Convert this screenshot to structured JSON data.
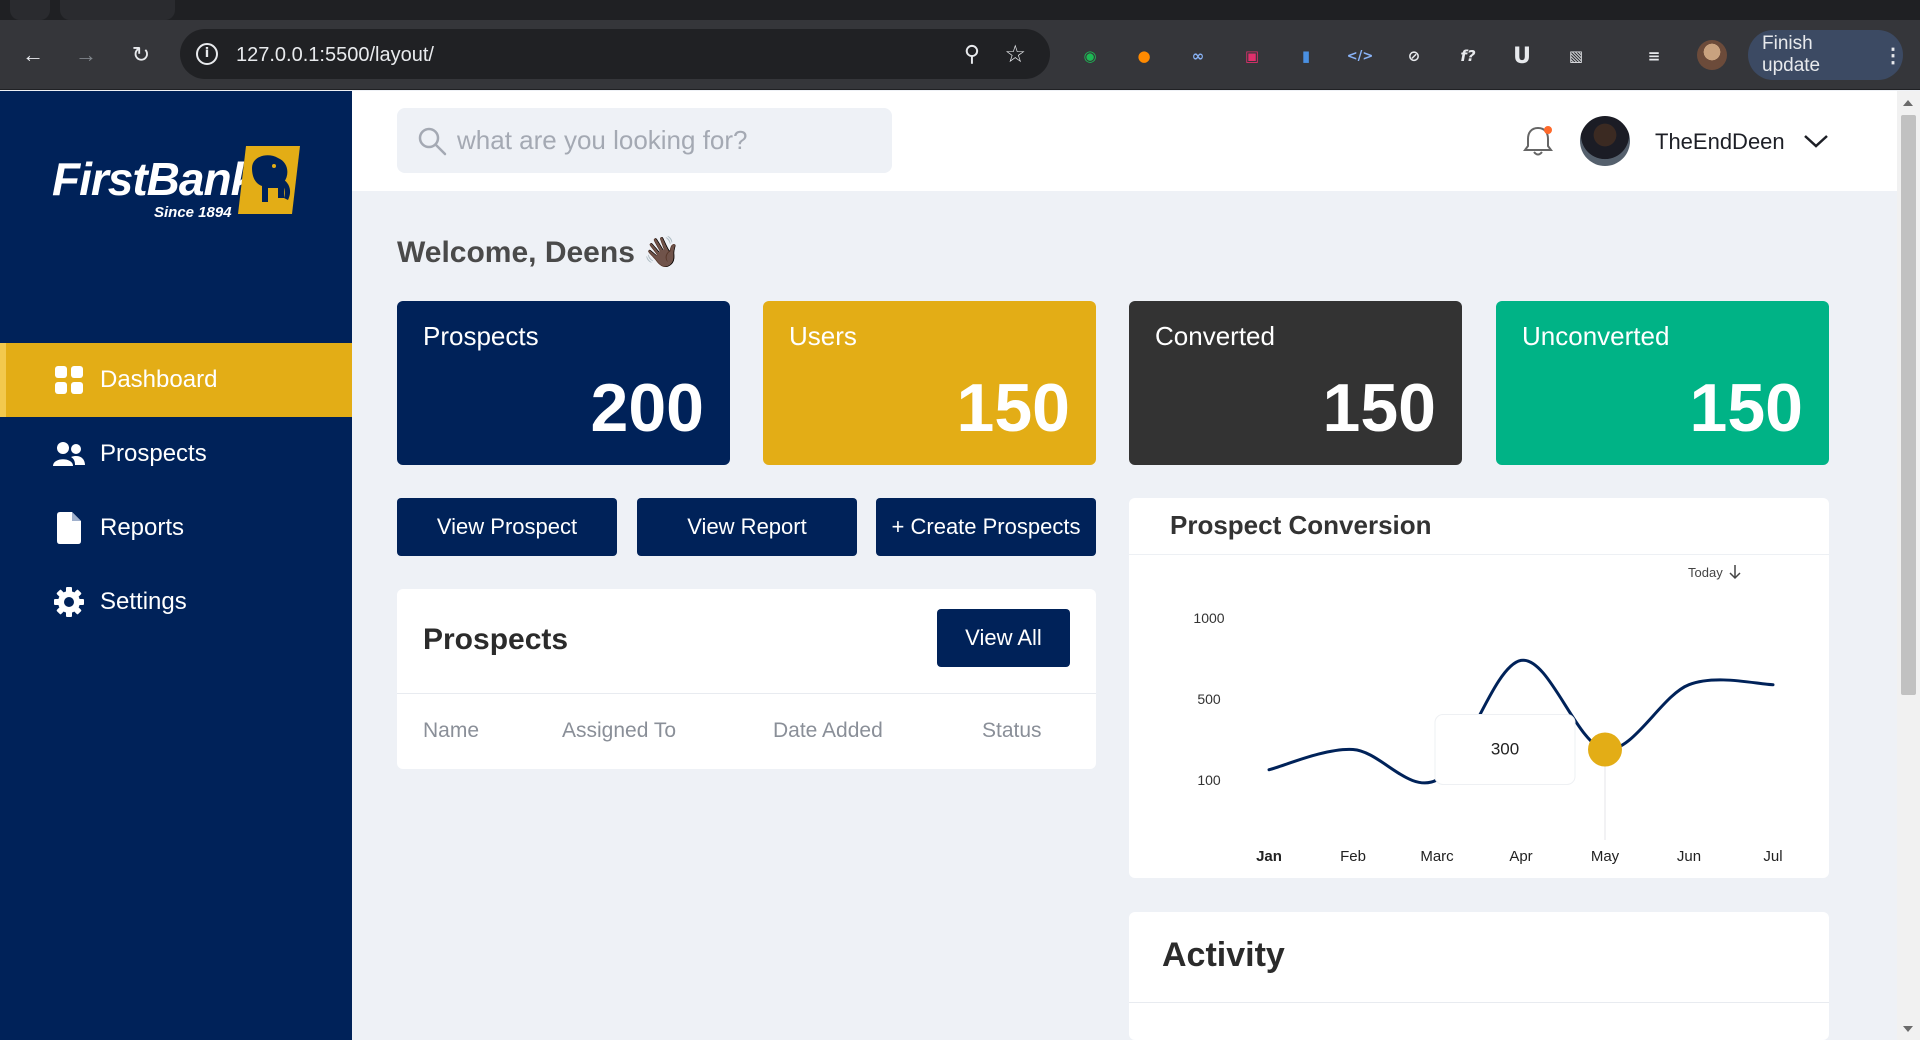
{
  "browser": {
    "url": "127.0.0.1:5500/layout/",
    "update_label": "Finish update",
    "extensions": [
      "grammarly-icon",
      "firefox-icon",
      "link-icon",
      "instagram-icon",
      "docs-icon",
      "code-icon",
      "compass-icon",
      "fx-icon",
      "u-icon",
      "puzzle-icon",
      "media-icon"
    ]
  },
  "brand": {
    "name": "FirstBank",
    "tagline": "Since 1894",
    "primary": "#002259",
    "accent": "#e3ad16"
  },
  "sidebar": {
    "items": [
      {
        "label": "Dashboard",
        "icon": "grid-icon",
        "active": true
      },
      {
        "label": "Prospects",
        "icon": "users-icon",
        "active": false
      },
      {
        "label": "Reports",
        "icon": "file-icon",
        "active": false
      },
      {
        "label": "Settings",
        "icon": "gear-icon",
        "active": false
      }
    ]
  },
  "header": {
    "search_placeholder": "what are you looking for?",
    "username": "TheEndDeen"
  },
  "main": {
    "welcome": "Welcome, Deens 👋🏿",
    "cards": [
      {
        "label": "Prospects",
        "value": "200",
        "color": "#002259"
      },
      {
        "label": "Users",
        "value": "150",
        "color": "#e3ad16"
      },
      {
        "label": "Converted",
        "value": "150",
        "color": "#333333"
      },
      {
        "label": "Unconverted",
        "value": "150",
        "color": "#00b386"
      }
    ],
    "actions": [
      "View Prospect",
      "View Report",
      "+ Create Prospects"
    ],
    "prospects_table": {
      "title": "Prospects",
      "view_all": "View All",
      "columns": [
        "Name",
        "Assigned To",
        "Date Added",
        "Status"
      ]
    },
    "chart": {
      "title": "Prospect Conversion",
      "filter": "Today",
      "tooltip": "300"
    },
    "activity": {
      "title": "Activity"
    }
  },
  "chart_data": {
    "type": "line",
    "categories": [
      "Jan",
      "Feb",
      "Marc",
      "Apr",
      "May",
      "Jun",
      "Jul"
    ],
    "y_ticks": [
      "1000",
      "500",
      "100"
    ],
    "values": [
      200,
      300,
      150,
      800,
      300,
      650,
      650
    ],
    "highlight": {
      "category": "May",
      "label": "300"
    },
    "line_color": "#002259",
    "marker_color": "#e3ad16"
  }
}
